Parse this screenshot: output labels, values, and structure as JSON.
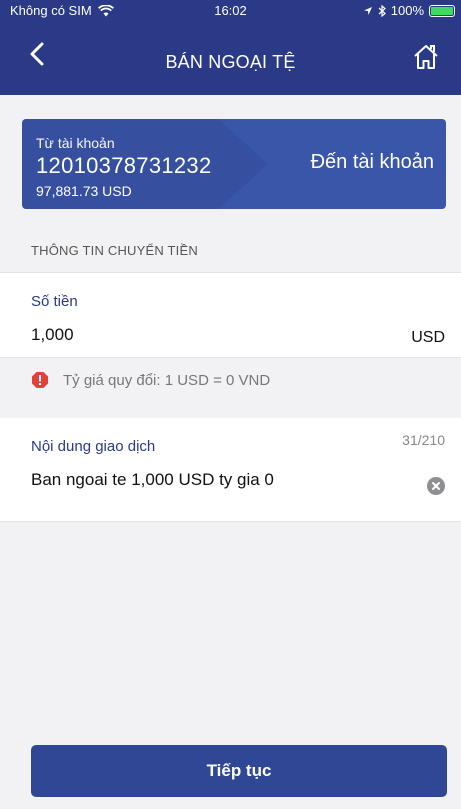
{
  "status_bar": {
    "carrier": "Không có SIM",
    "time": "16:02",
    "battery": "100%"
  },
  "header": {
    "title": "BÁN NGOẠI TỆ"
  },
  "from_account": {
    "label": "Từ tài khoản",
    "number": "12010378731232",
    "balance": "97,881.73 USD"
  },
  "to_account": {
    "label": "Đến tài khoản"
  },
  "section": {
    "transfer_info": "THÔNG TIN CHUYỂN TIỀN"
  },
  "amount": {
    "label": "Số tiền",
    "value": "1,000",
    "currency": "USD"
  },
  "exchange_rate": {
    "text": "Tỷ giá quy đổi: 1 USD = 0 VND"
  },
  "description": {
    "label": "Nội dung giao dịch",
    "counter": "31/210",
    "value": "Ban ngoai te 1,000 USD ty gia 0"
  },
  "continue_button": {
    "label": "Tiếp tục"
  },
  "colors": {
    "primary": "#2b3a86",
    "card": "#36509f",
    "warning": "#e0413a"
  }
}
